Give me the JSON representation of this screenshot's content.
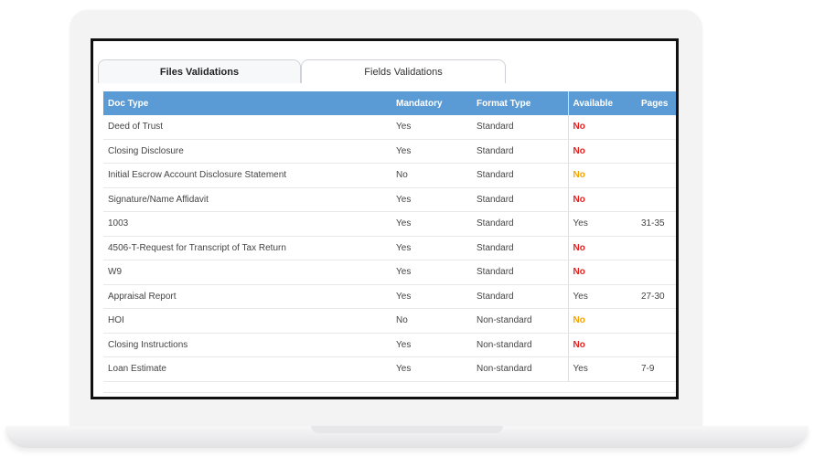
{
  "tabs": [
    {
      "label": "Files Validations",
      "active": true
    },
    {
      "label": "Fields Validations",
      "active": false
    }
  ],
  "table": {
    "headers": {
      "doc_type": "Doc Type",
      "mandatory": "Mandatory",
      "format_type": "Format Type",
      "available": "Available",
      "pages": "Pages"
    },
    "rows": [
      {
        "doc_type": "Deed of Trust",
        "mandatory": "Yes",
        "format_type": "Standard",
        "available": "No",
        "available_status": "red",
        "pages": ""
      },
      {
        "doc_type": "Closing Disclosure",
        "mandatory": "Yes",
        "format_type": "Standard",
        "available": "No",
        "available_status": "red",
        "pages": ""
      },
      {
        "doc_type": "Initial Escrow Account Disclosure Statement",
        "mandatory": "No",
        "format_type": "Standard",
        "available": "No",
        "available_status": "orange",
        "pages": ""
      },
      {
        "doc_type": "Signature/Name Affidavit",
        "mandatory": "Yes",
        "format_type": "Standard",
        "available": "No",
        "available_status": "red",
        "pages": ""
      },
      {
        "doc_type": "1003",
        "mandatory": "Yes",
        "format_type": "Standard",
        "available": "Yes",
        "available_status": "plain",
        "pages": "31-35"
      },
      {
        "doc_type": "4506-T-Request for Transcript of Tax Return",
        "mandatory": "Yes",
        "format_type": "Standard",
        "available": "No",
        "available_status": "red",
        "pages": ""
      },
      {
        "doc_type": "W9",
        "mandatory": "Yes",
        "format_type": "Standard",
        "available": "No",
        "available_status": "red",
        "pages": ""
      },
      {
        "doc_type": "Appraisal Report",
        "mandatory": "Yes",
        "format_type": "Standard",
        "available": "Yes",
        "available_status": "plain",
        "pages": "27-30"
      },
      {
        "doc_type": "HOI",
        "mandatory": "No",
        "format_type": "Non-standard",
        "available": "No",
        "available_status": "orange",
        "pages": ""
      },
      {
        "doc_type": "Closing Instructions",
        "mandatory": "Yes",
        "format_type": "Non-standard",
        "available": "No",
        "available_status": "red",
        "pages": ""
      },
      {
        "doc_type": "Loan Estimate",
        "mandatory": "Yes",
        "format_type": "Non-standard",
        "available": "Yes",
        "available_status": "plain",
        "pages": "7-9"
      }
    ]
  },
  "colors": {
    "header_bg": "#5b9bd5",
    "no_red": "#e32020",
    "no_orange": "#f5a300"
  }
}
